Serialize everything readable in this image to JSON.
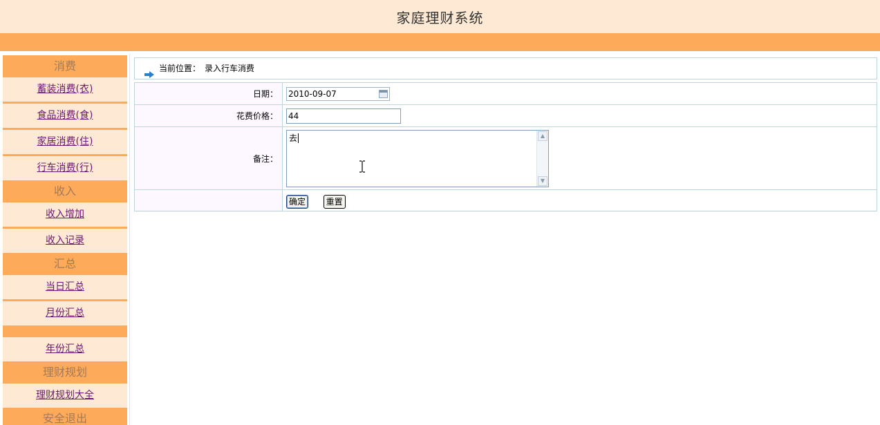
{
  "app": {
    "title": "家庭理财系统"
  },
  "sidebar": {
    "sections": [
      {
        "title": "消费",
        "items": [
          "蓄装消费(衣)",
          "食品消费(食)",
          "家居消费(住)",
          "行车消费(行)"
        ]
      },
      {
        "title": "收入",
        "items": [
          "收入增加",
          "收入记录"
        ]
      },
      {
        "title": "汇总",
        "items": [
          "当日汇总",
          "月份汇总",
          "年份汇总"
        ]
      },
      {
        "title": "理财规划",
        "items": [
          "理财规划大全"
        ]
      },
      {
        "title": "安全退出",
        "items": []
      }
    ]
  },
  "breadcrumb": {
    "label": "当前位置：",
    "page": "录入行车消费"
  },
  "form": {
    "date_label": "日期：",
    "date_value": "2010-09-07",
    "price_label": "花费价格：",
    "price_value": "44",
    "note_label": "备注：",
    "note_value": "去",
    "submit_label": "确定",
    "reset_label": "重置"
  },
  "colors": {
    "header_bg": "#feead4",
    "accent": "#fdaa5a",
    "link": "#6b1772",
    "border": "#bdd5df"
  },
  "icons": [
    "arrow-right-icon",
    "calendar-icon",
    "text-cursor-icon"
  ]
}
